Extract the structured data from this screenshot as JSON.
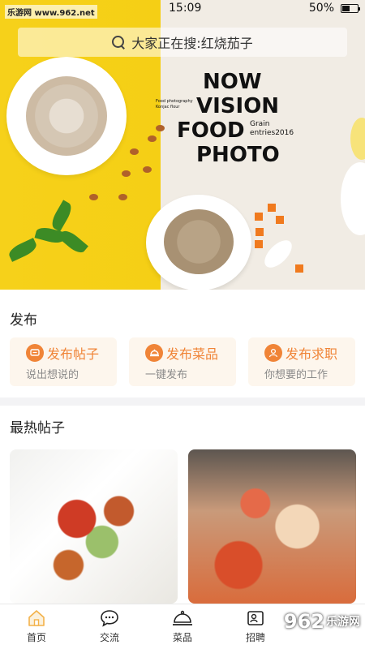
{
  "watermark": {
    "top_left": "乐游网 www.962.net",
    "bottom_right": "962",
    "bottom_right_sub": "乐游网"
  },
  "status_bar": {
    "time": "15:09",
    "battery": "50%"
  },
  "search": {
    "placeholder": "大家正在搜:红烧茄子"
  },
  "banner": {
    "title_lines": [
      "NOW",
      "VISION",
      "FOOD",
      "PHOTO"
    ],
    "side_text": [
      "Grain",
      "entries2016"
    ],
    "small_text": [
      "Food photography",
      "Konjac flour"
    ]
  },
  "publish": {
    "title": "发布",
    "cards": [
      {
        "label": "发布帖子",
        "sub": "说出想说的",
        "icon": "post-icon"
      },
      {
        "label": "发布菜品",
        "sub": "一键发布",
        "icon": "dish-icon"
      },
      {
        "label": "发布求职",
        "sub": "你想要的工作",
        "icon": "job-icon"
      }
    ]
  },
  "hot_posts": {
    "title": "最热帖子"
  },
  "tabs": [
    {
      "label": "首页",
      "icon": "home-icon",
      "active": true
    },
    {
      "label": "交流",
      "icon": "chat-icon",
      "active": false
    },
    {
      "label": "菜品",
      "icon": "cloche-icon",
      "active": false
    },
    {
      "label": "招聘",
      "icon": "recruit-icon",
      "active": false
    }
  ],
  "colors": {
    "accent": "#f08437",
    "card_bg": "#fdf6ed",
    "banner_yellow": "#f6d11a"
  }
}
